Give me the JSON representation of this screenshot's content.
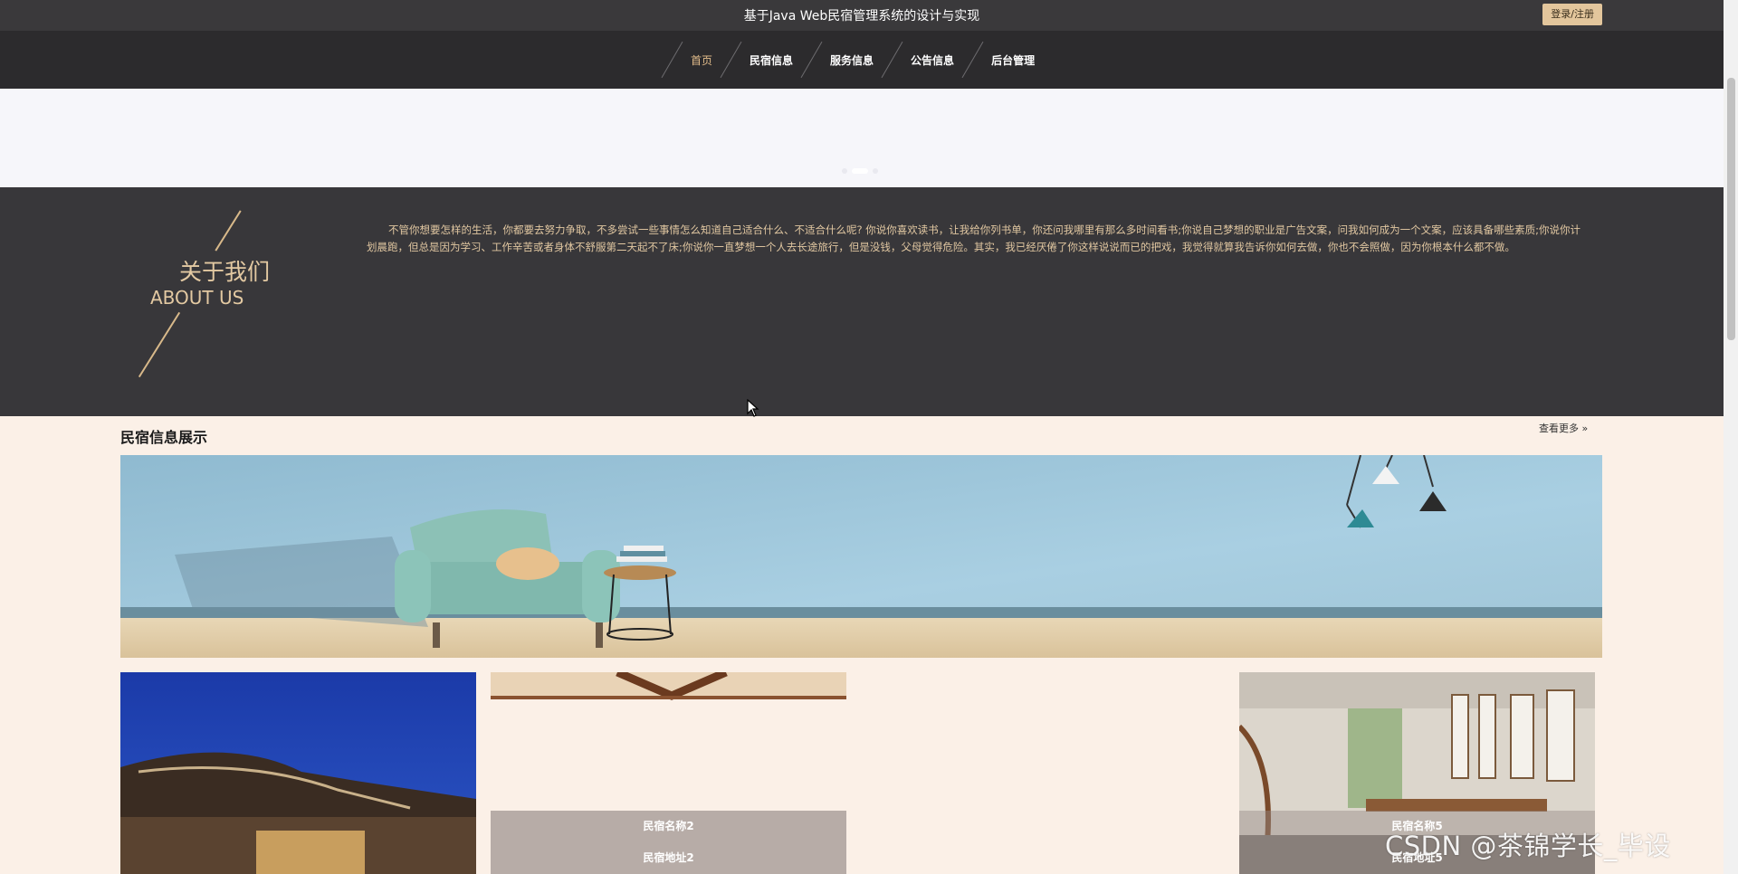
{
  "header": {
    "title": "基于Java Web民宿管理系统的设计与实现",
    "login_label": "登录/注册"
  },
  "nav": {
    "items": [
      {
        "label": "首页",
        "active": true
      },
      {
        "label": "民宿信息",
        "active": false
      },
      {
        "label": "服务信息",
        "active": false
      },
      {
        "label": "公告信息",
        "active": false
      },
      {
        "label": "后台管理",
        "active": false
      }
    ]
  },
  "banner": {
    "active_slide": 2,
    "slide_count": 3
  },
  "about": {
    "title_cn": "关于我们",
    "title_en": "ABOUT US",
    "text": "不管你想要怎样的生活，你都要去努力争取，不多尝试一些事情怎么知道自己适合什么、不适合什么呢? 你说你喜欢读书，让我给你列书单，你还问我哪里有那么多时间看书;你说自己梦想的职业是广告文案，问我如何成为一个文案，应该具备哪些素质;你说你计划晨跑，但总是因为学习、工作辛苦或者身体不舒服第二天起不了床;你说你一直梦想一个人去长途旅行，但是没钱，父母觉得危险。其实，我已经厌倦了你这样说说而已的把戏，我觉得就算我告诉你如何去做，你也不会照做，因为你根本什么都不做。"
  },
  "section": {
    "title": "民宿信息展示",
    "more_label": "查看更多"
  },
  "cards": [
    {
      "name": "",
      "address": ""
    },
    {
      "name": "民宿名称2",
      "address": "民宿地址2"
    },
    {
      "name": "民宿名称5",
      "address": "民宿地址5"
    }
  ],
  "watermark": "CSDN @茶锦学长_毕设",
  "colors": {
    "topbar": "#3a393b",
    "nav": "#2c2b2d",
    "accent": "#e3bd8b",
    "about_bg": "#38373a",
    "page_bg": "#fbf0e7"
  }
}
